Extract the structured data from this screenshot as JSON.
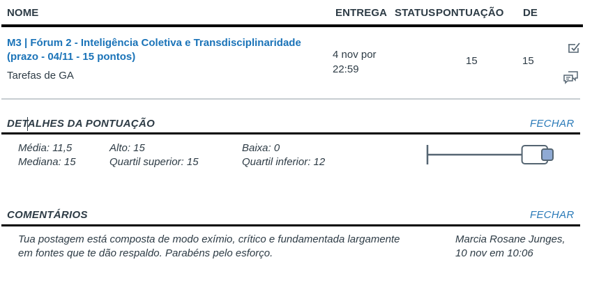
{
  "table": {
    "headers": {
      "name": "NOME",
      "due": "ENTREGA",
      "status": "STATUS",
      "score": "PONTUAÇÃO",
      "out_of": "DE"
    }
  },
  "assignment": {
    "title_line1": "M3 | Fórum 2 - Inteligência Coletiva e Transdisciplinaridade",
    "title_line2": "(prazo - 04/11 - 15 pontos)",
    "group": "Tarefas de GA",
    "due_line1": "4 nov por",
    "due_line2": "22:59",
    "score": "15",
    "out_of": "15",
    "icons": [
      "rubric-check-icon",
      "comments-icon"
    ]
  },
  "score_details": {
    "title": "DETALHES DA PONTUAÇÃO",
    "close_label": "FECHAR",
    "mean": "Média: 11,5",
    "median": "Mediana: 15",
    "high": "Alto: 15",
    "upper_quartile": "Quartil superior: 15",
    "low": "Baixa: 0",
    "lower_quartile": "Quartil inferior: 12",
    "boxplot": {
      "min": 0,
      "lower_quartile": 12,
      "median": 15,
      "upper_quartile": 15,
      "max": 15,
      "your_score": 15
    }
  },
  "comments": {
    "title": "COMENTÁRIOS",
    "close_label": "FECHAR",
    "text_line1": "Tua postagem está composta de modo exímio, crítico e fundamentada largamente",
    "text_line2": "em fontes que te dão respaldo. Parabéns pelo esforço.",
    "author": "Marcia Rosane Junges,",
    "date": "10 nov em 10:06"
  },
  "colors": {
    "link": "#1a73b8",
    "text": "#2d3b45",
    "boxplot_line": "#556572",
    "score_dot": "#8faad4"
  }
}
